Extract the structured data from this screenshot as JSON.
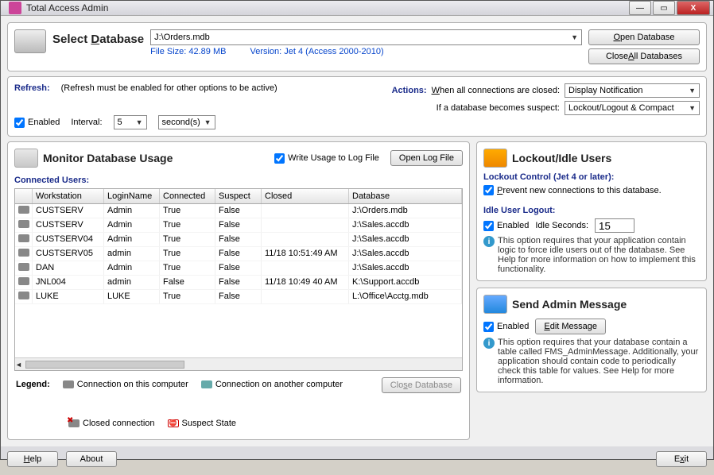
{
  "window": {
    "title": "Total Access Admin"
  },
  "selectDb": {
    "label": "Select Database",
    "value": "J:\\Orders.mdb",
    "fileSizeLabel": "File Size: 42.89 MB",
    "versionLabel": "Version: Jet 4 (Access 2000-2010)",
    "openBtn": "Open Database",
    "closeAllBtn": "Close All Databases"
  },
  "refresh": {
    "label": "Refresh:",
    "note": "(Refresh must be enabled for other options to be active)",
    "enabled": "Enabled",
    "intervalLabel": "Interval:",
    "intervalValue": "5",
    "intervalUnit": "second(s)"
  },
  "actions": {
    "label": "Actions:",
    "whenClosed": "When all connections are closed:",
    "whenClosedValue": "Display Notification",
    "ifSuspect": "If a database becomes suspect:",
    "ifSuspectValue": "Lockout/Logout & Compact"
  },
  "monitor": {
    "title": "Monitor Database Usage",
    "writeLog": "Write Usage to Log File",
    "openLogBtn": "Open Log File",
    "connectedUsers": "Connected Users:",
    "columns": [
      "",
      "Workstation",
      "LoginName",
      "Connected",
      "Suspect",
      "Closed",
      "Database"
    ],
    "rows": [
      {
        "ws": "CUSTSERV",
        "login": "Admin",
        "conn": "True",
        "susp": "False",
        "closed": "",
        "db": "J:\\Orders.mdb"
      },
      {
        "ws": "CUSTSERV",
        "login": "Admin",
        "conn": "True",
        "susp": "False",
        "closed": "",
        "db": "J:\\Sales.accdb"
      },
      {
        "ws": "CUSTSERV04",
        "login": "Admin",
        "conn": "True",
        "susp": "False",
        "closed": "",
        "db": "J:\\Sales.accdb"
      },
      {
        "ws": "CUSTSERV05",
        "login": "admin",
        "conn": "True",
        "susp": "False",
        "closed": "11/18 10:51:49 AM",
        "db": "J:\\Sales.accdb"
      },
      {
        "ws": "DAN",
        "login": "Admin",
        "conn": "True",
        "susp": "False",
        "closed": "",
        "db": "J:\\Sales.accdb"
      },
      {
        "ws": "JNL004",
        "login": "admin",
        "conn": "False",
        "susp": "False",
        "closed": "11/18 10:49 40 AM",
        "db": "K:\\Support.accdb"
      },
      {
        "ws": "LUKE",
        "login": "LUKE",
        "conn": "True",
        "susp": "False",
        "closed": "",
        "db": "L:\\Office\\Acctg.mdb"
      }
    ],
    "legendLabel": "Legend:",
    "legend": {
      "onThis": "Connection on this computer",
      "onOther": "Connection on another computer",
      "closed": "Closed connection",
      "suspect": "Suspect State"
    },
    "closeDbBtn": "Close Database"
  },
  "lockout": {
    "title": "Lockout/Idle Users",
    "controlHeading": "Lockout Control (Jet 4 or later):",
    "preventNew": "Prevent new connections to this database.",
    "idleHeading": "Idle User Logout:",
    "enabled": "Enabled",
    "idleSecondsLabel": "Idle Seconds:",
    "idleSecondsValue": "15",
    "info": "This option requires that your application contain logic to force idle users out of the database. See Help for more information on how to implement this functionality."
  },
  "sendMsg": {
    "title": "Send Admin Message",
    "enabled": "Enabled",
    "editBtn": "Edit Message",
    "info": "This option requires that your database contain a table called FMS_AdminMessage. Additionally, your application should contain code to periodically check this table for values. See Help for more information."
  },
  "footer": {
    "help": "Help",
    "about": "About",
    "exit": "Exit"
  }
}
